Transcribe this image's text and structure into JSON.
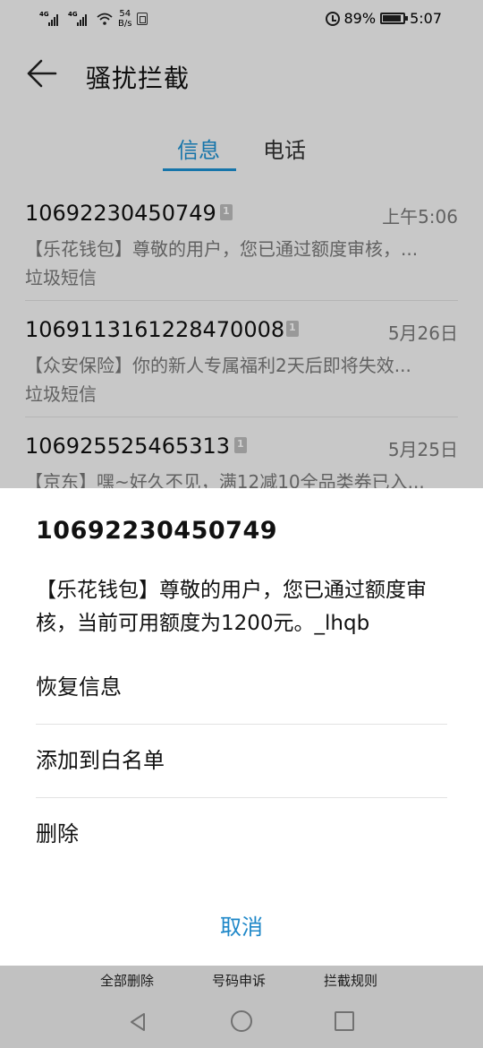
{
  "status_bar": {
    "net1": "4G",
    "net2": "4G",
    "speed_value": "54",
    "speed_unit": "B/s",
    "battery": "89%",
    "time": "5:07"
  },
  "header": {
    "title": "骚扰拦截"
  },
  "tabs": [
    {
      "label": "信息",
      "active": true
    },
    {
      "label": "电话",
      "active": false
    }
  ],
  "messages": [
    {
      "number": "10692230450749",
      "time": "上午5:06",
      "preview": "【乐花钱包】尊敬的用户，您已通过额度审核，...",
      "category": "垃圾短信"
    },
    {
      "number": "1069113161228470008",
      "time": "5月26日",
      "preview": "【众安保险】你的新人专属福利2天后即将失效...",
      "category": "垃圾短信"
    },
    {
      "number": "106925525465313",
      "time": "5月25日",
      "preview": "【京东】嘿~好久不见，满12减10全品类券已入..."
    }
  ],
  "sheet": {
    "title": "10692230450749",
    "body": "【乐花钱包】尊敬的用户，您已通过额度审核，当前可用额度为1200元。_lhqb",
    "options": [
      "恢复信息",
      "添加到白名单",
      "删除"
    ],
    "cancel": "取消"
  },
  "toolbar": [
    "全部删除",
    "号码申诉",
    "拦截规则"
  ],
  "colors": {
    "accent": "#1b8fd0",
    "cancel": "#1e87c8"
  }
}
